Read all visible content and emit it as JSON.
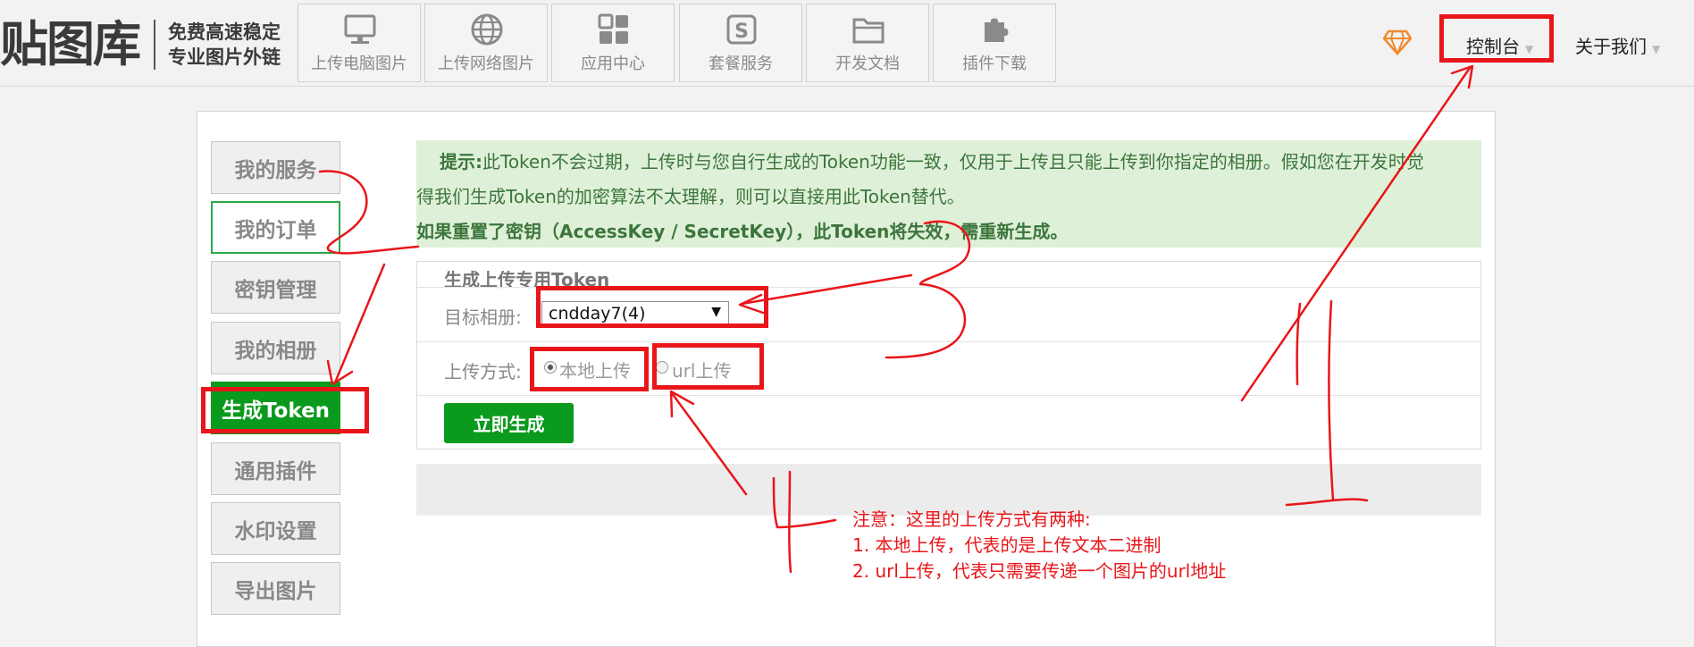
{
  "header": {
    "logo_text": "贴图库",
    "logo_sub_line1": "免费高速稳定",
    "logo_sub_line2": "专业图片外链",
    "nav": [
      {
        "label": "上传电脑图片",
        "icon": "monitor-icon"
      },
      {
        "label": "上传网络图片",
        "icon": "globe-icon"
      },
      {
        "label": "应用中心",
        "icon": "apps-grid-icon"
      },
      {
        "label": "套餐服务",
        "icon": "dollar-box-icon"
      },
      {
        "label": "开发文档",
        "icon": "folder-icon"
      },
      {
        "label": "插件下载",
        "icon": "puzzle-icon"
      }
    ],
    "console_label": "控制台",
    "about_label": "关于我们",
    "gem_icon": "diamond-icon"
  },
  "sidebar": {
    "items": [
      {
        "label": "我的服务"
      },
      {
        "label": "我的订单"
      },
      {
        "label": "密钥管理"
      },
      {
        "label": "我的相册"
      },
      {
        "label": "生成Token"
      },
      {
        "label": "通用插件"
      },
      {
        "label": "水印设置"
      },
      {
        "label": "导出图片"
      }
    ]
  },
  "tip": {
    "prefix": "提示:",
    "line1": "此Token不会过期，上传时与您自行生成的Token功能一致，仅用于上传且只能上传到你指定的相册。假如您在开发时觉",
    "line2": "得我们生成Token的加密算法不太理解，则可以直接用此Token替代。",
    "warning": "如果重置了密钥（AccessKey / SecretKey），此Token将失效，需重新生成。"
  },
  "generator": {
    "title": "生成上传专用Token",
    "album_label": "目标相册:",
    "album_value": "cndday7(4)",
    "method_label": "上传方式:",
    "options": [
      "本地上传",
      "url上传"
    ],
    "selected_option": "本地上传",
    "generate_button": "立即生成"
  },
  "note": {
    "line1": "注意：这里的上传方式有两种:",
    "line2": "1. 本地上传，代表的是上传文本二进制",
    "line3": "2. url上传，代表只需要传递一个图片的url地址"
  },
  "colors": {
    "accent_green": "#0a9a1d",
    "annotation_red": "#e8161a",
    "tip_background": "#dff0d8",
    "tip_text": "#3c763d"
  }
}
